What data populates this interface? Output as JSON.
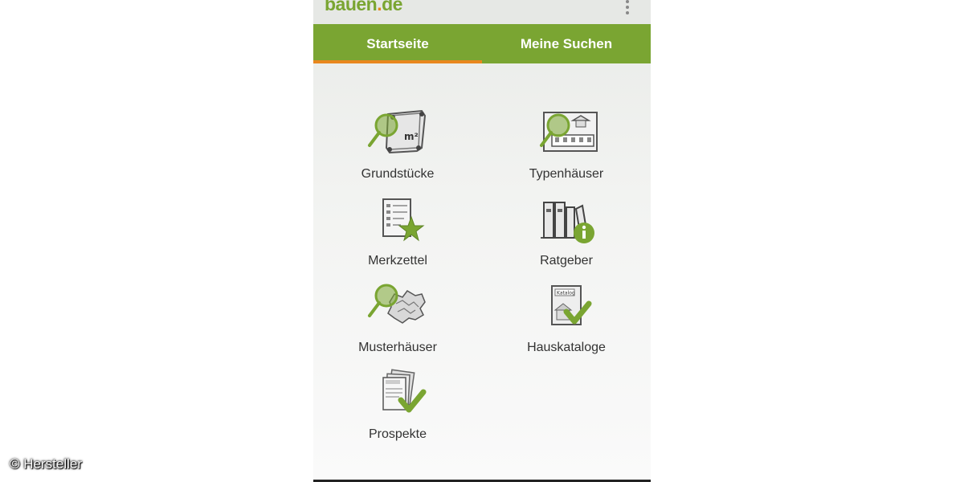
{
  "app": {
    "logo_text": "bauen",
    "logo_dot": ".",
    "logo_tld": "de",
    "menu_icon": "overflow-menu-icon"
  },
  "tabs": [
    {
      "label": "Startseite",
      "active": true
    },
    {
      "label": "Meine Suchen",
      "active": false
    }
  ],
  "menu": [
    {
      "label": "Grundstücke",
      "icon": "plot-search-icon"
    },
    {
      "label": "Typenhäuser",
      "icon": "house-search-icon"
    },
    {
      "label": "Merkzettel",
      "icon": "notepad-star-icon"
    },
    {
      "label": "Ratgeber",
      "icon": "books-info-icon"
    },
    {
      "label": "Musterhäuser",
      "icon": "model-house-search-icon"
    },
    {
      "label": "Hauskataloge",
      "icon": "catalog-check-icon"
    },
    {
      "label": "Prospekte",
      "icon": "brochure-check-icon"
    }
  ],
  "colors": {
    "brand_green": "#7aa532",
    "accent_orange": "#e8871e"
  },
  "credit": "© Hersteller"
}
